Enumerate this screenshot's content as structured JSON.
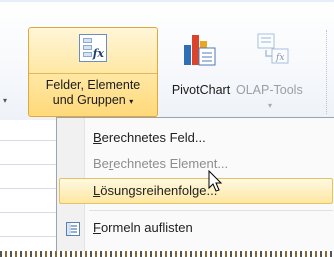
{
  "ribbon": {
    "fields_button": {
      "label_line1": "Felder, Elemente",
      "label_line2": "und Gruppen",
      "caret": "▾",
      "icon": "fx-table-icon"
    },
    "pivotchart_button": {
      "label": "PivotChart",
      "icon": "pivot-chart-icon"
    },
    "olap_button": {
      "label": "OLAP-Tools",
      "icon": "olap-tools-icon",
      "caret": "▾"
    },
    "left_caret": "▾"
  },
  "menu": {
    "items": [
      {
        "mnemonic": "B",
        "rest": "erechnetes Feld...",
        "enabled": true,
        "icon": ""
      },
      {
        "pre": "Be",
        "mnemonic": "r",
        "rest": "echnetes Element...",
        "enabled": false,
        "icon": ""
      },
      {
        "mnemonic": "L",
        "rest": "ösungsreihenfolge...",
        "enabled": true,
        "hover": true,
        "icon": ""
      },
      {
        "mnemonic": "F",
        "rest": "ormeln auflisten",
        "enabled": true,
        "icon": "list-formulas-icon"
      }
    ]
  },
  "colors": {
    "hover_fill": "#ffe7a2",
    "hover_border": "#e5c365",
    "active_button": "#ffd97a",
    "disabled_text": "#8d8d8d"
  }
}
